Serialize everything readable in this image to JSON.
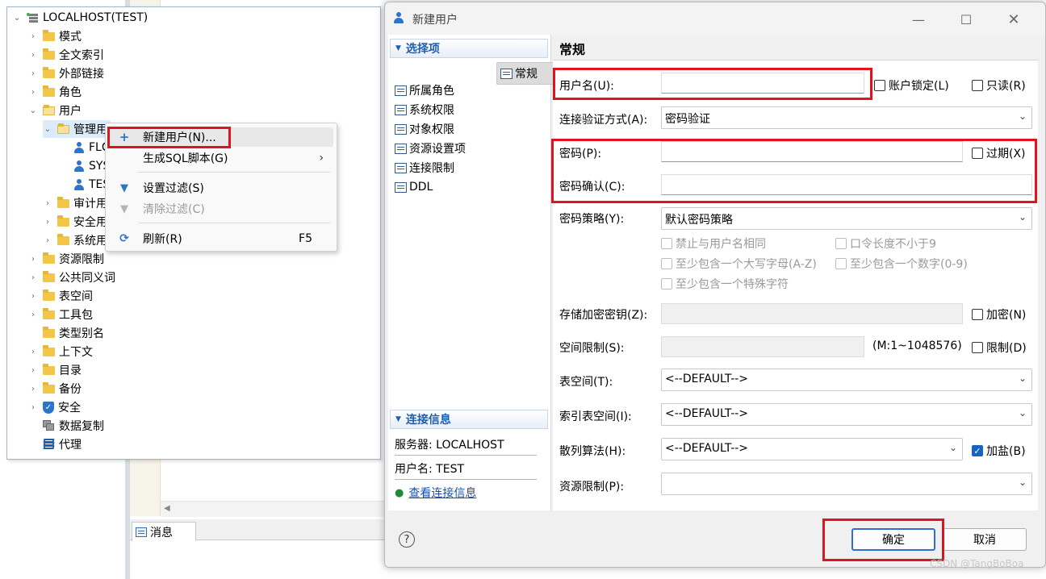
{
  "tree": {
    "root": "LOCALHOST(TEST)",
    "items": [
      {
        "label": "模式"
      },
      {
        "label": "全文索引"
      },
      {
        "label": "外部链接"
      },
      {
        "label": "角色"
      },
      {
        "label": "用户"
      },
      {
        "label": "管理用"
      },
      {
        "label": "FLC"
      },
      {
        "label": "SYS"
      },
      {
        "label": "TES"
      },
      {
        "label": "审计用"
      },
      {
        "label": "安全用"
      },
      {
        "label": "系统用"
      },
      {
        "label": "资源限制"
      },
      {
        "label": "公共同义词"
      },
      {
        "label": "表空间"
      },
      {
        "label": "工具包"
      },
      {
        "label": "类型别名"
      },
      {
        "label": "上下文"
      },
      {
        "label": "目录"
      },
      {
        "label": "备份"
      },
      {
        "label": "安全"
      },
      {
        "label": "数据复制"
      },
      {
        "label": "代理"
      }
    ]
  },
  "context_menu": {
    "items": [
      {
        "label": "新建用户(N)...",
        "shortcut": ""
      },
      {
        "label": "生成SQL脚本(G)",
        "shortcut": ""
      },
      {
        "label": "设置过滤(S)",
        "shortcut": ""
      },
      {
        "label": "清除过滤(C)",
        "shortcut": ""
      },
      {
        "label": "刷新(R)",
        "shortcut": "F5"
      }
    ]
  },
  "messages_tab": "消息",
  "dialog": {
    "title": "新建用户",
    "sidebar": {
      "options_header": "选择项",
      "items": [
        "常规",
        "所属角色",
        "系统权限",
        "对象权限",
        "资源设置项",
        "连接限制",
        "DDL"
      ],
      "conn_header": "连接信息",
      "server": "服务器: LOCALHOST",
      "username": "用户名: TEST",
      "view_link": "查看连接信息"
    },
    "form": {
      "section_title": "常规",
      "username_label": "用户名(U):",
      "username_value": "",
      "account_lock_label": "账户锁定(L)",
      "readonly_label": "只读(R)",
      "auth_label": "连接验证方式(A):",
      "auth_value": "密码验证",
      "password_label": "密码(P):",
      "expire_label": "过期(X)",
      "password_confirm_label": "密码确认(C):",
      "policy_label": "密码策略(Y):",
      "policy_value": "默认密码策略",
      "policy_options": [
        "禁止与用户名相同",
        "口令长度不小于9",
        "至少包含一个大写字母(A-Z)",
        "至少包含一个数字(0-9)",
        "至少包含一个特殊字符"
      ],
      "enc_key_label": "存储加密密钥(Z):",
      "encrypt_label": "加密(N)",
      "space_limit_label": "空间限制(S):",
      "space_range": "(M:1~1048576)",
      "limit_label": "限制(D)",
      "tablespace_label": "表空间(T):",
      "tablespace_value": "<--DEFAULT-->",
      "index_tablespace_label": "索引表空间(I):",
      "index_tablespace_value": "<--DEFAULT-->",
      "hash_label": "散列算法(H):",
      "hash_value": "<--DEFAULT-->",
      "salt_label": "加盐(B)",
      "salt_checked": true,
      "resource_limit_label": "资源限制(P):",
      "resource_limit_value": ""
    },
    "buttons": {
      "ok": "确定",
      "cancel": "取消",
      "help": "?"
    }
  },
  "watermark": "CSDN @TangBoBoa",
  "colors": {
    "highlight_red": "#e0141e",
    "accent_blue": "#1e5fae",
    "folder": "#f3c64a"
  }
}
